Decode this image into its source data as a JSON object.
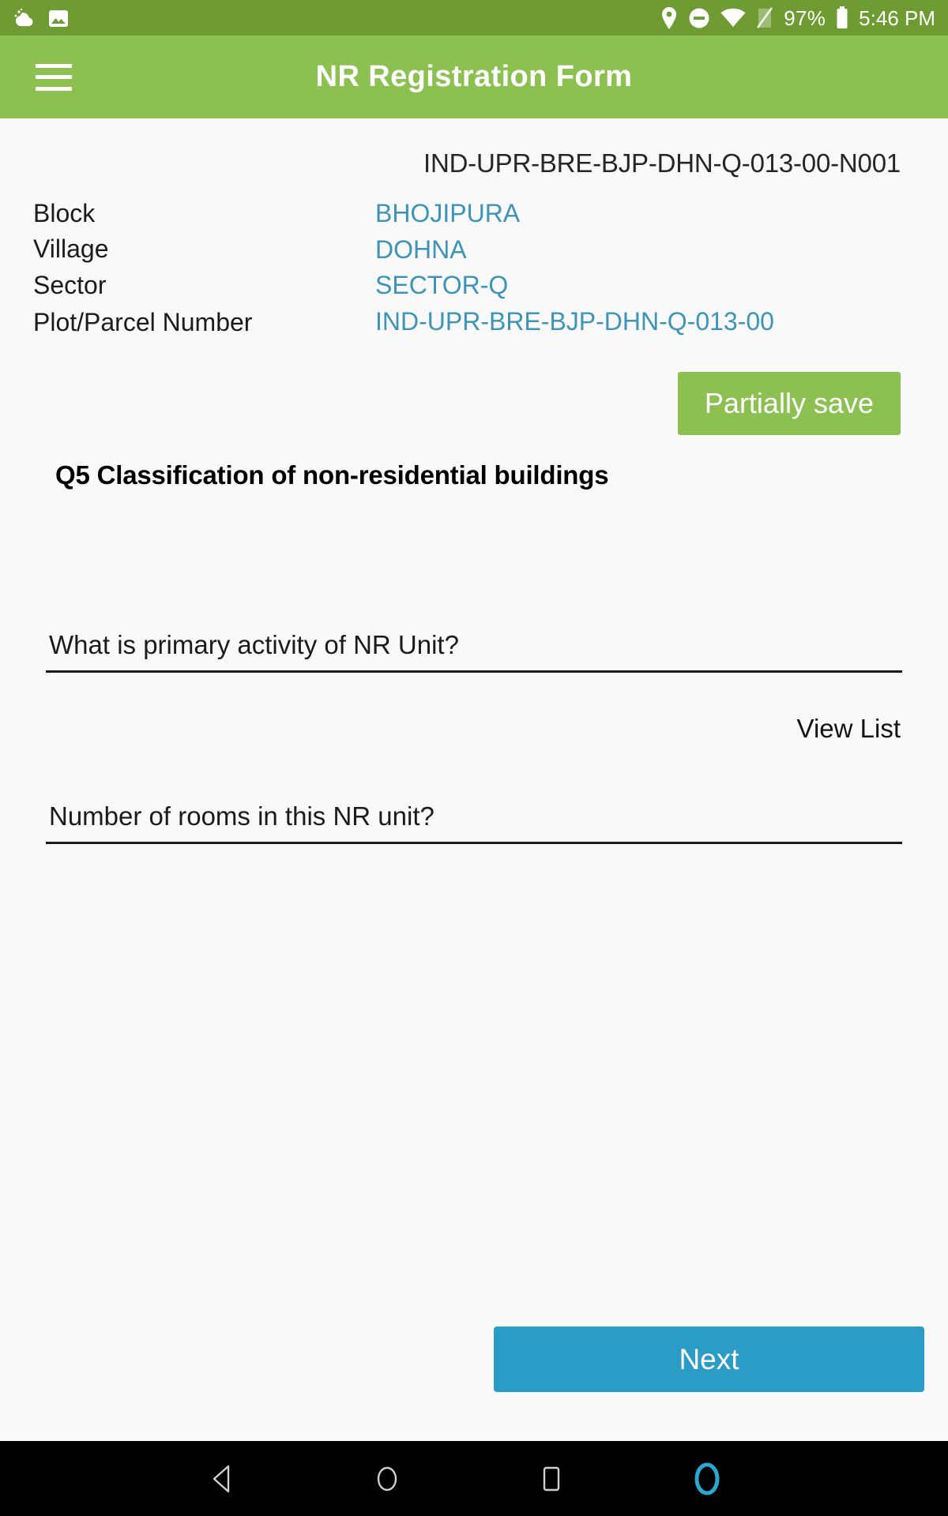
{
  "status_bar": {
    "left_icons": [
      "weather-cloud-icon",
      "screenshot-image-icon"
    ],
    "right_icons": [
      "location-pin-icon",
      "do-not-disturb-icon",
      "wifi-icon",
      "no-sim-signal-icon",
      "battery-icon"
    ],
    "battery_percent": "97%",
    "time": "5:46 PM",
    "background_color": "#6f9b33"
  },
  "app_bar": {
    "menu_icon": "hamburger-menu-icon",
    "title": "NR Registration Form",
    "background_color": "#8cc152",
    "title_color": "#ffffff"
  },
  "record": {
    "id": "IND-UPR-BRE-BJP-DHN-Q-013-00-N001",
    "value_color": "#3d94b8",
    "fields": [
      {
        "label": "Block",
        "value": "BHOJIPURA"
      },
      {
        "label": "Village",
        "value": "DOHNA"
      },
      {
        "label": "Sector",
        "value": "SECTOR-Q"
      },
      {
        "label": "Plot/Parcel Number",
        "value": "IND-UPR-BRE-BJP-DHN-Q-013-00"
      }
    ]
  },
  "partially_save": {
    "label": "Partially save",
    "background_color": "#8cc152"
  },
  "question": {
    "heading": "Q5 Classification of non-residential buildings"
  },
  "form": {
    "primary_activity": {
      "label": "What is primary activity of NR Unit?",
      "value": "",
      "placeholder": "What is primary activity of NR Unit?"
    },
    "view_list": {
      "label": "View List"
    },
    "rooms": {
      "label": "Number of rooms in this NR unit?",
      "value": "",
      "placeholder": "Number of rooms in this NR unit?"
    }
  },
  "next": {
    "label": "Next",
    "background_color": "#2a9cc6"
  },
  "nav_bar": {
    "icons": [
      "back-triangle-icon",
      "home-circle-icon",
      "recents-square-icon",
      "assistant-circle-icon"
    ],
    "background_color": "#000000",
    "assistant_color": "#29a8d0"
  }
}
